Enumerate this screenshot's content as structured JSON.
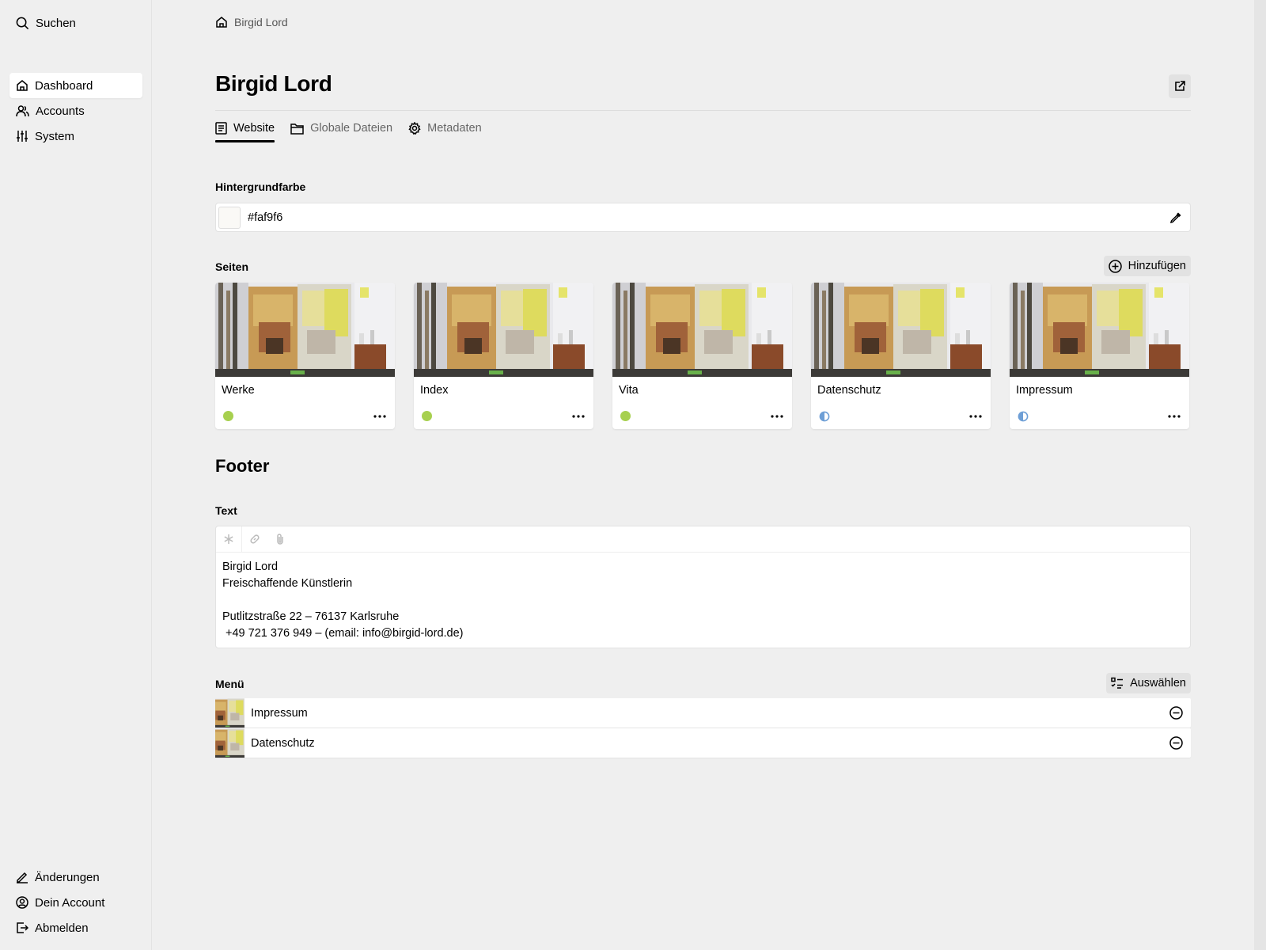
{
  "sidebar": {
    "search_label": "Suchen",
    "nav": [
      {
        "label": "Dashboard",
        "active": true
      },
      {
        "label": "Accounts",
        "active": false
      },
      {
        "label": "System",
        "active": false
      }
    ],
    "bottom_nav": [
      {
        "label": "Änderungen"
      },
      {
        "label": "Dein Account"
      },
      {
        "label": "Abmelden"
      }
    ]
  },
  "breadcrumb": {
    "label": "Birgid Lord"
  },
  "page": {
    "title": "Birgid Lord"
  },
  "tabs": [
    {
      "label": "Website",
      "active": true
    },
    {
      "label": "Globale Dateien",
      "active": false
    },
    {
      "label": "Metadaten",
      "active": false
    }
  ],
  "background_color": {
    "label": "Hintergrundfarbe",
    "value": "#faf9f6"
  },
  "pages_section": {
    "label": "Seiten",
    "add_label": "Hinzufügen",
    "cards": [
      {
        "title": "Werke",
        "status": "published"
      },
      {
        "title": "Index",
        "status": "published"
      },
      {
        "title": "Vita",
        "status": "published"
      },
      {
        "title": "Datenschutz",
        "status": "unlisted"
      },
      {
        "title": "Impressum",
        "status": "unlisted"
      }
    ]
  },
  "footer": {
    "heading": "Footer",
    "text_label": "Text",
    "text_lines": [
      "Birgid Lord",
      "Freischaffende Künstlerin",
      "",
      "Putlitzstraße 22 – 76137 Karlsruhe",
      " +49 721 376 949 – (email: info@birgid-lord.de)"
    ]
  },
  "menu": {
    "label": "Menü",
    "select_label": "Auswählen",
    "items": [
      {
        "label": "Impressum"
      },
      {
        "label": "Datenschutz"
      }
    ]
  },
  "colors": {
    "status_published": "#a7d04f",
    "status_unlisted": "#6e9fd6",
    "accent_text": "#000000"
  }
}
